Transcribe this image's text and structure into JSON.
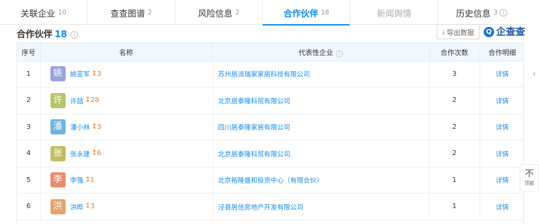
{
  "tabs": [
    {
      "label": "关联企业",
      "count": "10"
    },
    {
      "label": "查查图谱",
      "count": "2"
    },
    {
      "label": "风险信息",
      "count": "2"
    },
    {
      "label": "合作伙伴",
      "count": "18"
    },
    {
      "label": "新闻舆情",
      "count": ""
    },
    {
      "label": "历史信息",
      "count": "3"
    }
  ],
  "section": {
    "title": "合作伙伴",
    "count": "18",
    "export_label": "导出数据",
    "logo_text": "企查查"
  },
  "table": {
    "headers": {
      "index": "序号",
      "name": "名称",
      "company": "代表性企业",
      "count": "合作次数",
      "detail": "合作明细"
    },
    "rows": [
      {
        "index": "1",
        "avatar": "姚",
        "avatar_color": "#9aa2e0",
        "name": "姚亚军",
        "relations": "3",
        "company": "苏州居派瑞家家居科技有限公司",
        "count": "3",
        "detail": "详情"
      },
      {
        "index": "2",
        "avatar": "许",
        "avatar_color": "#b6c56e",
        "name": "许喆",
        "relations": "28",
        "company": "北京居泰隆科贸有限公司",
        "count": "2",
        "detail": "详情"
      },
      {
        "index": "3",
        "avatar": "潘",
        "avatar_color": "#6fb3de",
        "name": "潘小林",
        "relations": "3",
        "company": "四川居泰隆家居有限公司",
        "count": "2",
        "detail": "详情"
      },
      {
        "index": "4",
        "avatar": "张",
        "avatar_color": "#c1bd63",
        "name": "张永建",
        "relations": "6",
        "company": "北京居泰隆科贸有限公司",
        "count": "2",
        "detail": "详情"
      },
      {
        "index": "5",
        "avatar": "李",
        "avatar_color": "#e88c71",
        "name": "李强",
        "relations": "1",
        "company": "北京裕隆盛和投资中心（有限合伙）",
        "count": "1",
        "detail": "详情"
      },
      {
        "index": "6",
        "avatar": "洪",
        "avatar_color": "#e6a36f",
        "name": "洪晔",
        "relations": "3",
        "company": "泾县居佳房地产开发有限公司",
        "count": "1",
        "detail": "详情"
      }
    ]
  },
  "to_top_label": "顶部",
  "colors": {
    "accent": "#128bed",
    "relation": "#f0781e",
    "header_bg": "#f2f8ff"
  }
}
